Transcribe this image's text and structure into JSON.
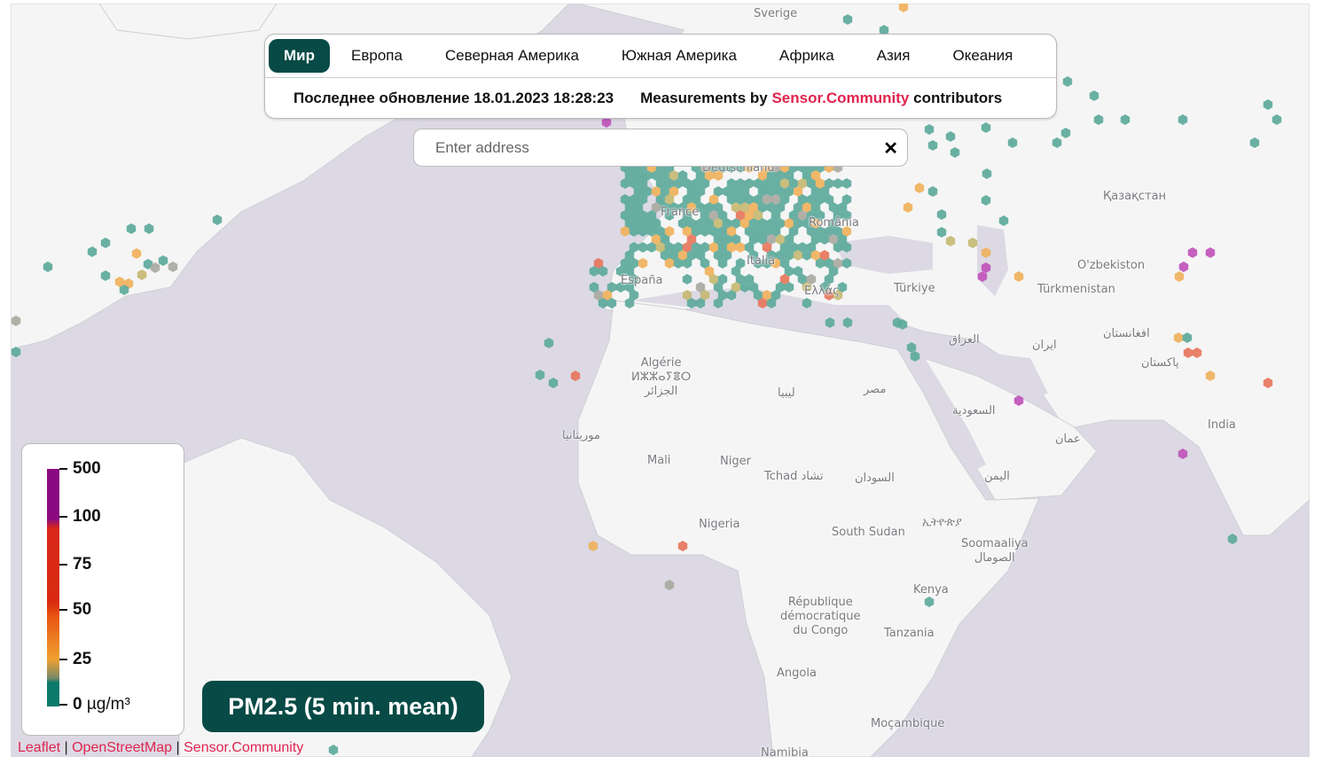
{
  "nav": {
    "tabs": [
      {
        "label": "Мир",
        "active": true
      },
      {
        "label": "Европа"
      },
      {
        "label": "Северная Америка"
      },
      {
        "label": "Южная Америка"
      },
      {
        "label": "Африка"
      },
      {
        "label": "Азия"
      },
      {
        "label": "Океания"
      }
    ],
    "last_update": "Последнее обновление 18.01.2023 18:28:23",
    "measurements_prefix": "Measurements by",
    "measurements_link": "Sensor.Community",
    "measurements_suffix": "contributors"
  },
  "search": {
    "placeholder": "Enter address",
    "value": "",
    "clear_icon": "close-icon"
  },
  "legend": {
    "ticks": [
      "500",
      "100",
      "75",
      "50",
      "25",
      "0"
    ],
    "unit": "µg/m³",
    "colors": {
      "high": "#8b0a82",
      "very_bad": "#d92a10",
      "bad": "#e85512",
      "moderate": "#f0a030",
      "good": "#0c7a6a"
    }
  },
  "sensor": {
    "label": "PM2.5 (5 min. mean)"
  },
  "attribution": {
    "leaflet": "Leaflet",
    "osm": "OpenStreetMap",
    "sc": "Sensor.Community",
    "sep": "|"
  },
  "map_labels": [
    "Sverige",
    "Deutschland",
    "France",
    "România",
    "España",
    "Italia",
    "Ελλάς",
    "Türkiye",
    "Қазақстан",
    "O'zbekiston",
    "Türkmenistan",
    "افغانستان",
    "ایران",
    "العراق",
    "پاکستان",
    "India",
    "Algérie / ⵍⵣⵣⴰⵢⴻⵔ / الجزائر",
    "ليبيا",
    "مصر",
    "السعودية",
    "عمان",
    "اليمن",
    "موريتانيا",
    "Mali",
    "Niger",
    "Tchad تشاد",
    "السودان",
    "Nigeria",
    "South Sudan",
    "ኢትዮጵያ",
    "Soomaaliya الصومال",
    "Kenya",
    "République démocratique du Congo",
    "Tanzania",
    "Angola",
    "Moçambique",
    "Namibia"
  ],
  "colors": {
    "ocean": "#dcd9e4",
    "land": "#f5f5f5",
    "accent": "#074a46",
    "link": "#e0244e"
  }
}
